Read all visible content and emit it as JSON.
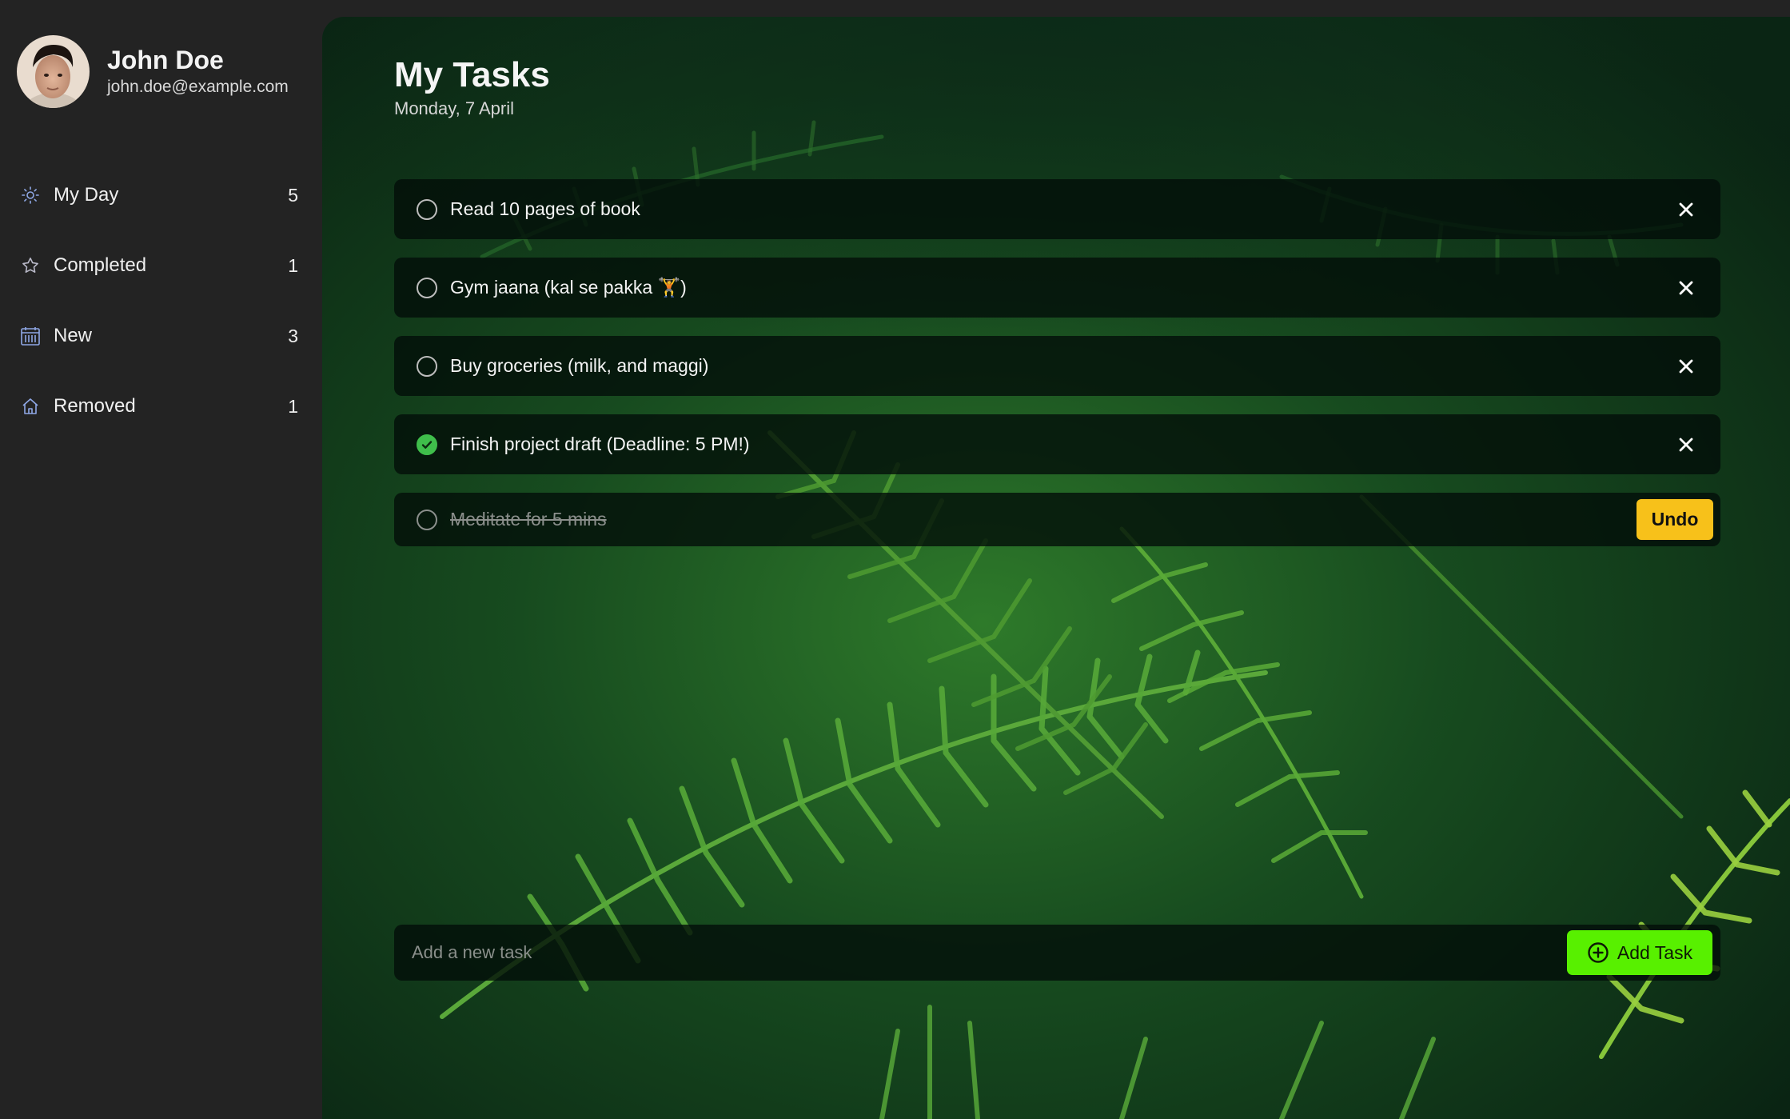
{
  "user": {
    "name": "John Doe",
    "email": "john.doe@example.com"
  },
  "nav": [
    {
      "label": "My Day",
      "count": "5",
      "icon": "sun-icon"
    },
    {
      "label": "Completed",
      "count": "1",
      "icon": "star-icon"
    },
    {
      "label": "New",
      "count": "3",
      "icon": "calendar-icon"
    },
    {
      "label": "Removed",
      "count": "1",
      "icon": "home-icon"
    }
  ],
  "main": {
    "title": "My Tasks",
    "date": "Monday, 7 April"
  },
  "tasks": [
    {
      "text": "Read 10 pages of book",
      "done": false
    },
    {
      "text": "Gym jaana (kal se pakka 🏋️)",
      "done": false
    },
    {
      "text": "Buy groceries (milk, and maggi)",
      "done": false
    },
    {
      "text": "Finish project draft (Deadline: 5 PM!)",
      "done": true
    }
  ],
  "removed_task": {
    "text": "Meditate for 5 mins",
    "undo_label": "Undo"
  },
  "add_task": {
    "placeholder": "Add a new task",
    "button_label": "Add Task"
  },
  "colors": {
    "sidebar_bg": "#232323",
    "check_done": "#3fbe4b",
    "undo_bg": "#f7c11a",
    "add_btn_bg": "#58f000"
  }
}
